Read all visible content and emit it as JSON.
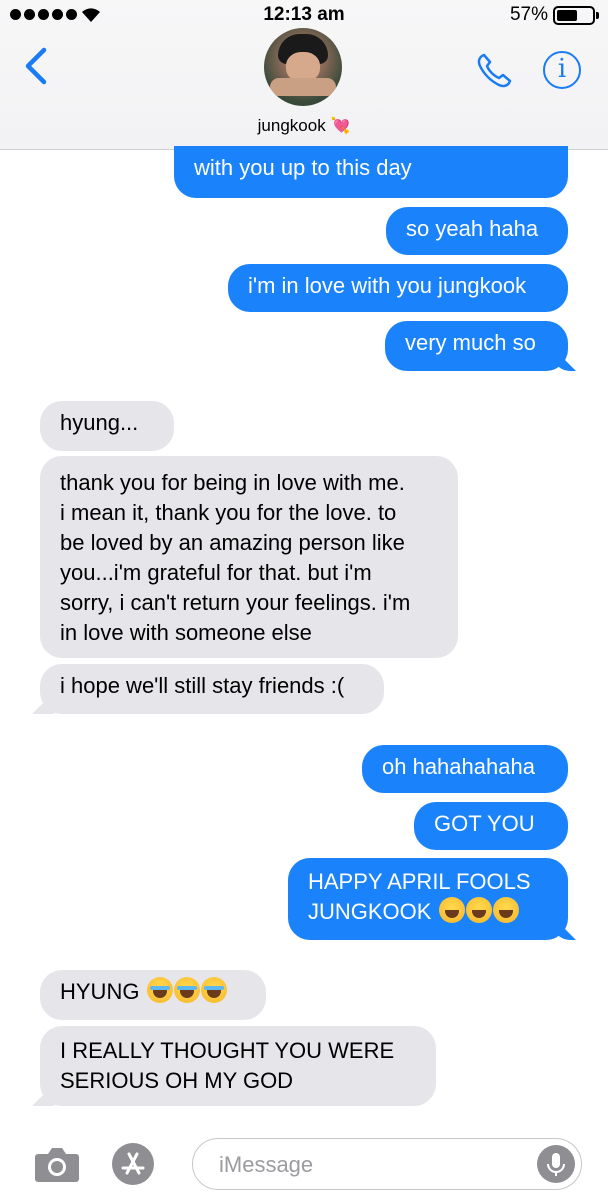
{
  "status_bar": {
    "time": "12:13 am",
    "battery": "57%"
  },
  "header": {
    "contact_name": "jungkook",
    "contact_emoji": "💘"
  },
  "messages": [
    {
      "side": "sent",
      "text": "with you up to this day"
    },
    {
      "side": "sent",
      "text": "so yeah haha"
    },
    {
      "side": "sent",
      "text": "i'm in love with you jungkook"
    },
    {
      "side": "sent",
      "text": "very much so"
    },
    {
      "side": "received",
      "text": "hyung..."
    },
    {
      "side": "received",
      "lines": [
        "thank you for being in love with me.",
        "i mean it, thank you for the love. to",
        "be loved by an amazing person like",
        "you...i'm grateful for that. but i'm",
        "sorry, i can't return your feelings. i'm",
        "in love with someone else"
      ]
    },
    {
      "side": "received",
      "text": "i hope we'll still stay friends :("
    },
    {
      "side": "sent",
      "text": "oh hahahahaha"
    },
    {
      "side": "sent",
      "text": "GOT YOU"
    },
    {
      "side": "sent",
      "lines": [
        "HAPPY APRIL FOOLS",
        "JUNGKOOK"
      ],
      "emoji": "😂😂😂"
    },
    {
      "side": "received",
      "text": "HYUNG",
      "emoji": "😭😭😭"
    },
    {
      "side": "received",
      "lines": [
        "I REALLY THOUGHT YOU WERE",
        "SERIOUS OH MY GOD"
      ]
    }
  ],
  "input": {
    "placeholder": "iMessage"
  },
  "colors": {
    "accent": "#1a7cf5",
    "sent_bubble": "#1a82fb",
    "received_bubble": "#e6e5ea"
  },
  "icons": [
    "back-chevron-icon",
    "phone-icon",
    "info-icon",
    "camera-icon",
    "app-store-icon",
    "microphone-icon"
  ]
}
